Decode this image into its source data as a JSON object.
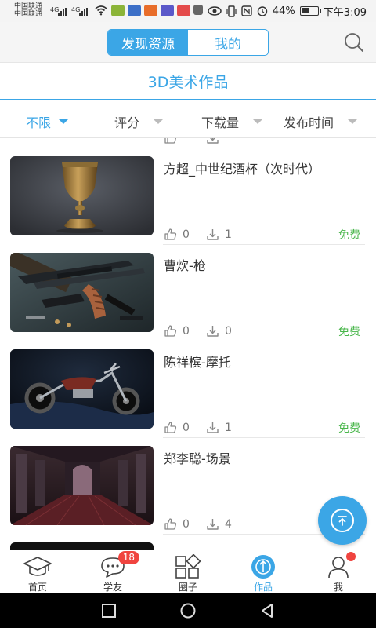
{
  "status_bar": {
    "carrier_1": "中国联通",
    "carrier_2": "中国联通",
    "signal_1": "4G",
    "signal_2": "4G",
    "battery": "44%",
    "time": "下午3:09"
  },
  "header": {
    "tabs": [
      {
        "label": "发现资源",
        "active": true
      },
      {
        "label": "我的",
        "active": false
      }
    ]
  },
  "page_title": "3D美术作品",
  "filters": [
    {
      "label": "不限",
      "active": true
    },
    {
      "label": "评分",
      "active": false
    },
    {
      "label": "下载量",
      "active": false
    },
    {
      "label": "发布时间",
      "active": false
    }
  ],
  "works": [
    {
      "title": "方超_中世纪酒杯（次时代）",
      "likes": "0",
      "downloads": "1",
      "price": "免费"
    },
    {
      "title": "曹炊-枪",
      "likes": "0",
      "downloads": "0",
      "price": "免费"
    },
    {
      "title": "陈祥槟-摩托",
      "likes": "0",
      "downloads": "1",
      "price": "免费"
    },
    {
      "title": "郑李聪-场景",
      "likes": "0",
      "downloads": "4",
      "price": ""
    }
  ],
  "tabbar": {
    "items": [
      {
        "label": "首页",
        "icon": "graduation-cap-icon"
      },
      {
        "label": "学友",
        "icon": "chat-bubble-icon",
        "badge": "18"
      },
      {
        "label": "圈子",
        "icon": "grid-icon"
      },
      {
        "label": "作品",
        "icon": "works-icon",
        "active": true
      },
      {
        "label": "我",
        "icon": "user-icon"
      }
    ]
  },
  "colors": {
    "accent": "#3ba6e6",
    "free": "#48b64a",
    "badge": "#f0443f"
  }
}
